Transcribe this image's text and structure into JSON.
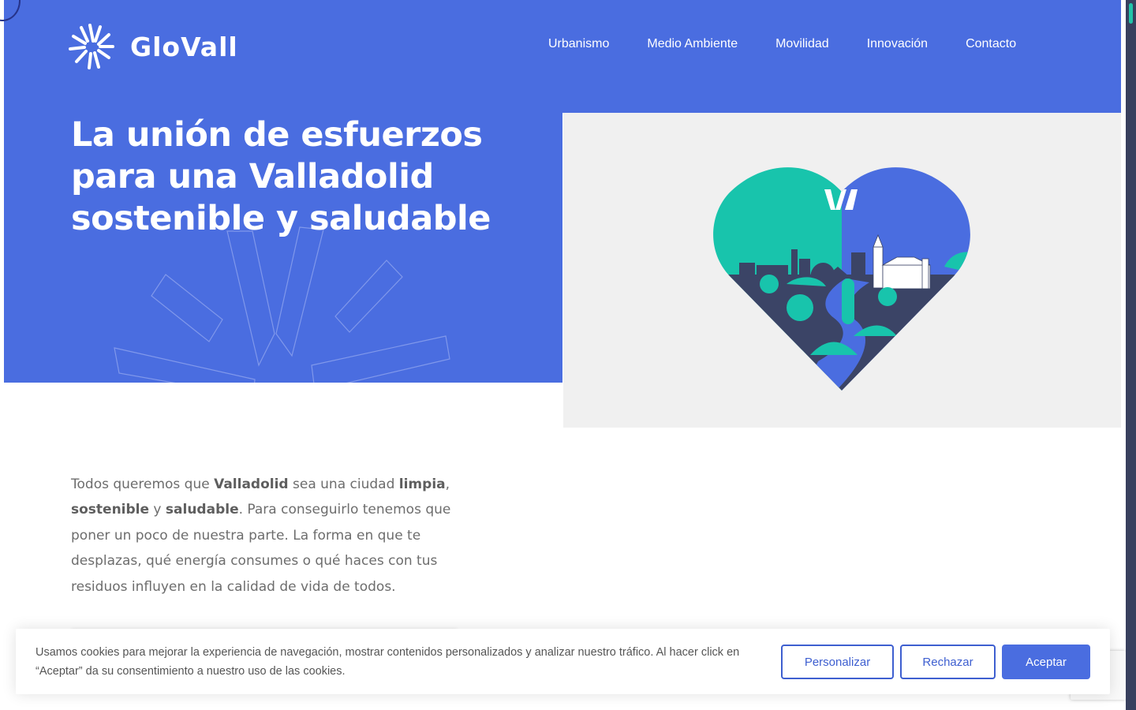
{
  "brand": {
    "name": "GloVall",
    "accent": "#4a6de0",
    "teal": "#22c4a9",
    "navy": "#38405e"
  },
  "nav": {
    "items": [
      {
        "label": "Urbanismo"
      },
      {
        "label": "Medio Ambiente"
      },
      {
        "label": "Movilidad"
      },
      {
        "label": "Innovación"
      },
      {
        "label": "Contacto"
      }
    ]
  },
  "hero": {
    "title_line1": "La unión de esfuerzos",
    "title_line2": "para una Valladolid",
    "title_hl1": "sostenible",
    "title_mid": " y ",
    "title_hl2": "saludable",
    "image_icon": "heart-city-illustration"
  },
  "intro": {
    "t1": "Todos queremos que ",
    "b1": "Valladolid",
    "t2": " sea una ciudad ",
    "b2": "limpia",
    "t3": ", ",
    "b3": "sostenible",
    "t4": " y ",
    "b4": "saludable",
    "t5": ". Para conseguirlo tenemos que poner un poco de nuestra parte. La forma en que te desplazas, qué energía consumes o qué haces con tus residuos influyen en la calidad de vida de todos."
  },
  "cookie": {
    "text": "Usamos cookies para mejorar la experiencia de navegación, mostrar contenidos personalizados y analizar nuestro tráfico. Al hacer click en “Aceptar” da su consentimiento a nuestro uso de las cookies.",
    "customize": "Personalizar",
    "reject": "Rechazar",
    "accept": "Aceptar"
  }
}
